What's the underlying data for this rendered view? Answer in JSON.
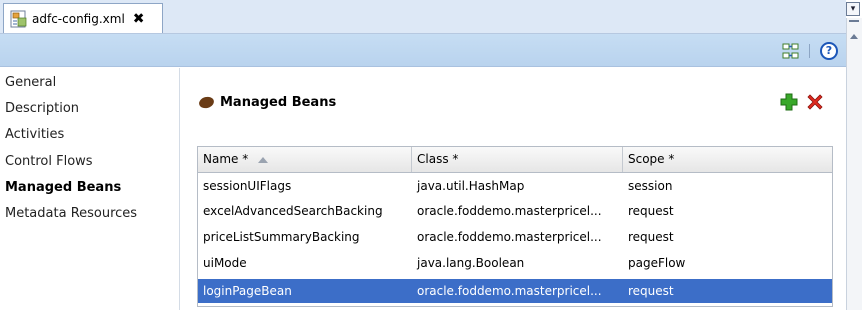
{
  "tab": {
    "title": "adfc-config.xml",
    "close": "✖"
  },
  "toolbar": {
    "help": "?"
  },
  "sidenav": {
    "items": [
      {
        "label": "General"
      },
      {
        "label": "Description"
      },
      {
        "label": "Activities"
      },
      {
        "label": "Control Flows"
      },
      {
        "label": "Managed Beans"
      },
      {
        "label": "Metadata Resources"
      }
    ]
  },
  "main": {
    "section_title": "Managed Beans",
    "table": {
      "columns": [
        "Name *",
        "Class *",
        "Scope *"
      ],
      "rows": [
        {
          "name": "sessionUIFlags",
          "class": "java.util.HashMap",
          "scope": "session"
        },
        {
          "name": "excelAdvancedSearchBacking",
          "class": "oracle.foddemo.masterpricel...",
          "scope": "request"
        },
        {
          "name": "priceListSummaryBacking",
          "class": "oracle.foddemo.masterpricel...",
          "scope": "request"
        },
        {
          "name": "uiMode",
          "class": "java.lang.Boolean",
          "scope": "pageFlow"
        },
        {
          "name": "loginPageBean",
          "class": "oracle.foddemo.masterpricel...",
          "scope": "request"
        }
      ]
    }
  },
  "colors": {
    "accent": "#3c6ec8",
    "toolbar": "#c6ddf3",
    "add": "#2f9e1f",
    "delete": "#d9261c"
  }
}
